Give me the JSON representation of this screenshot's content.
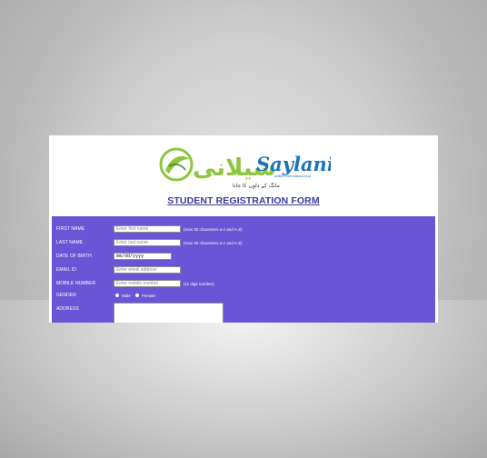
{
  "logo": {
    "urdu_text": "سیلانی",
    "latin_text": "Saylani",
    "subtitle": "welfare international trust",
    "tagline": "مانگ کے دلوں کا جانا"
  },
  "form": {
    "title": "STUDENT REGISTRATION FORM",
    "fields": {
      "first_name": {
        "label": "FIRST NAME",
        "placeholder": "Enter first name",
        "hint": "(max 30 characters a-z and A-Z)"
      },
      "last_name": {
        "label": "LAST NAME",
        "placeholder": "Enter last name",
        "hint": "(max 30 characters a-z and A-Z)"
      },
      "dob": {
        "label": "DATE OF BIRTH",
        "value": "mm/dd/yyyy"
      },
      "email": {
        "label": "EMAIL ID",
        "placeholder": "Enter email address"
      },
      "mobile": {
        "label": "MOBILE NUMBER",
        "placeholder": "Enter mobile number",
        "hint": "(11 digit number)"
      },
      "gender": {
        "label": "GENDER",
        "options": [
          "Male",
          "Female"
        ]
      },
      "address": {
        "label": "ADDRESS"
      }
    }
  },
  "colors": {
    "panel": "#6a55d6",
    "title": "#3c3a9e",
    "logo_green": "#8cc63f",
    "logo_blue": "#1b75bc"
  }
}
